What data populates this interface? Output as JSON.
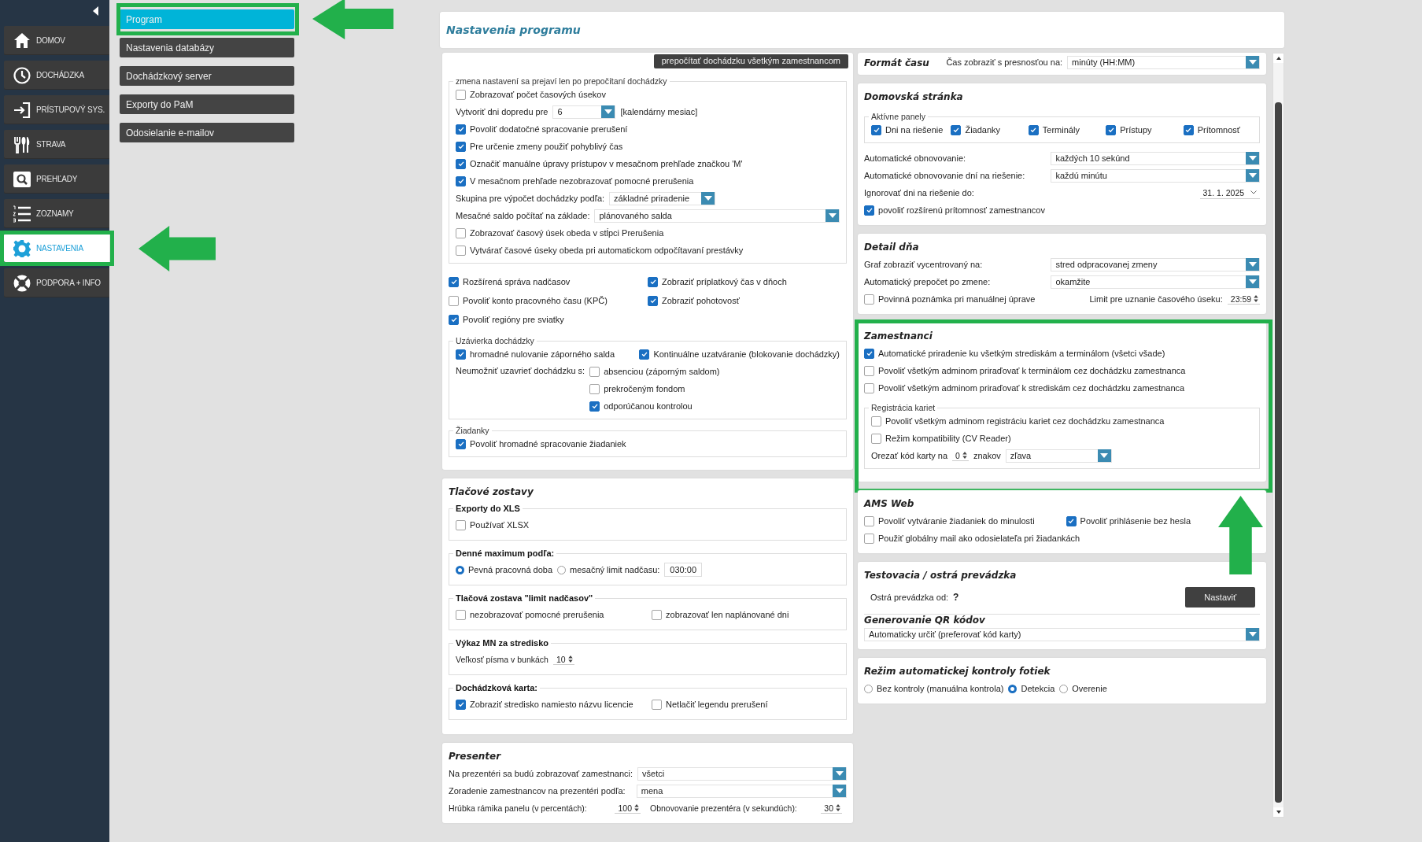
{
  "sidebar": {
    "items": [
      {
        "label": "DOMOV",
        "selected": false,
        "highlighted": false
      },
      {
        "label": "DOCHÁDZKA",
        "selected": false,
        "highlighted": false
      },
      {
        "label": "PRÍSTUPOVÝ SYS.",
        "selected": false,
        "highlighted": false
      },
      {
        "label": "STRAVA",
        "selected": false,
        "highlighted": false
      },
      {
        "label": "PREHĽADY",
        "selected": false,
        "highlighted": false
      },
      {
        "label": "ZOZNAMY",
        "selected": false,
        "highlighted": false
      },
      {
        "label": "NASTAVENIA",
        "selected": true,
        "highlighted": true
      },
      {
        "label": "PODPORA + INFO",
        "selected": false,
        "highlighted": false
      }
    ]
  },
  "submenu": [
    {
      "label": "Program",
      "selected": true,
      "highlighted": true
    },
    {
      "label": "Nastavenia databázy",
      "selected": false,
      "highlighted": false
    },
    {
      "label": "Dochádzkový server",
      "selected": false,
      "highlighted": false
    },
    {
      "label": "Exporty do PaM",
      "selected": false,
      "highlighted": false
    },
    {
      "label": "Odosielanie e-mailov",
      "selected": false,
      "highlighted": false
    }
  ],
  "header": {
    "title": "Nastavenia programu"
  },
  "left_column": [
    {
      "kind": "panel",
      "highlighted": false,
      "rows": [
        {
          "kind": "button",
          "label": "prepočítať dochádzku všetkým zamestnancom"
        },
        {
          "kind": "fieldset",
          "legend": "zmena nastavení sa prejaví len po prepočítaní dochádzky",
          "rows": [
            {
              "kind": "check",
              "label": "Zobrazovať počet časových úsekov",
              "checked": false
            },
            {
              "kind": "select-suffix",
              "label": "Vytvoriť dni dopredu pre",
              "value": "6",
              "suffix": "[kalendárny mesiac]"
            },
            {
              "kind": "check",
              "label": "Povoliť dodatočné spracovanie prerušení",
              "checked": true
            },
            {
              "kind": "check",
              "label": "Pre určenie zmeny použiť pohyblivý čas",
              "checked": true
            },
            {
              "kind": "check",
              "label": "Označiť manuálne úpravy prístupov v mesačnom prehľade značkou 'M'",
              "checked": true
            },
            {
              "kind": "check",
              "label": "V mesačnom prehľade nezobrazovať pomocné prerušenia",
              "checked": true
            },
            {
              "kind": "select-inline",
              "label": "Skupina pre výpočet dochádzky podľa:",
              "value": "základné priradenie"
            },
            {
              "kind": "select-fill",
              "label": "Mesačné saldo počítať na základe:",
              "value": "plánovaného salda"
            },
            {
              "kind": "check",
              "label": "Zobrazovať časový úsek obeda v stĺpci Prerušenia",
              "checked": false
            },
            {
              "kind": "check",
              "label": "Vytvárať časové úseky obeda pri automatickom odpočítavaní prestávky",
              "checked": false
            }
          ]
        },
        {
          "kind": "check-grid",
          "items": [
            {
              "label": "Rozšírená správa nadčasov",
              "checked": true
            },
            {
              "label": "Zobraziť príplatkový čas v dňoch",
              "checked": true
            },
            {
              "label": "Povoliť konto pracovného času (KPČ)",
              "checked": false
            },
            {
              "label": "Zobraziť pohotovosť",
              "checked": true
            },
            {
              "label": "Povoliť regióny pre sviatky",
              "checked": true
            }
          ]
        },
        {
          "kind": "fieldset",
          "legend": "Uzávierka dochádzky",
          "rows": [
            {
              "kind": "checks",
              "items": [
                {
                  "label": "hromadné nulovanie záporného salda",
                  "checked": true
                },
                {
                  "label": "Kontinuálne uzatváranie (blokovanie dochádzky)",
                  "checked": true
                }
              ]
            },
            {
              "kind": "check-stack",
              "label": "Neumožniť uzavrieť dochádzku s:",
              "items": [
                {
                  "label": "absenciou (záporným saldom)",
                  "checked": false
                },
                {
                  "label": "prekročeným fondom",
                  "checked": false
                },
                {
                  "label": "odporúčanou kontrolou",
                  "checked": true
                }
              ]
            }
          ]
        },
        {
          "kind": "fieldset",
          "legend": "Žiadanky",
          "rows": [
            {
              "kind": "check",
              "label": "Povoliť hromadné spracovanie žiadaniek",
              "checked": true
            }
          ]
        }
      ]
    },
    {
      "kind": "panel",
      "title": "Tlačové zostavy",
      "highlighted": false,
      "rows": [
        {
          "kind": "group",
          "legend": "Exporty do XLS",
          "rows": [
            {
              "kind": "check",
              "label": "Používať XLSX",
              "checked": false
            }
          ]
        },
        {
          "kind": "group",
          "legend": "Denné maximum podľa:",
          "rows": [
            {
              "kind": "radios",
              "items": [
                {
                  "label": "Pevná pracovná doba",
                  "selected": true
                },
                {
                  "label": "mesačný limit nadčasu:",
                  "selected": false
                }
              ],
              "input": "030:00"
            }
          ]
        },
        {
          "kind": "group",
          "legend": "Tlačová zostava \"limit nadčasov\"",
          "rows": [
            {
              "kind": "checks",
              "items": [
                {
                  "label": "nezobrazovať pomocné prerušenia",
                  "checked": false
                },
                {
                  "label": "zobrazovať len naplánované dni",
                  "checked": false
                }
              ]
            }
          ]
        },
        {
          "kind": "group",
          "legend": "Výkaz MN za stredisko",
          "rows": [
            {
              "kind": "spinner",
              "label": "Veľkosť písma v bunkách",
              "value": "10"
            }
          ]
        },
        {
          "kind": "group",
          "legend": "Dochádzková karta:",
          "rows": [
            {
              "kind": "checks",
              "items": [
                {
                  "label": "Zobraziť stredisko namiesto názvu licencie",
                  "checked": true
                },
                {
                  "label": "Netlačiť legendu prerušení",
                  "checked": false
                }
              ]
            }
          ]
        }
      ]
    },
    {
      "kind": "panel",
      "title": "Presenter",
      "highlighted": false,
      "rows": [
        {
          "kind": "select",
          "label": "Na prezentéri sa budú zobrazovať zamestnanci:",
          "value": "všetci"
        },
        {
          "kind": "select",
          "label": "Zoradenie zamestnancov na prezentéri podľa:",
          "value": "mena"
        },
        {
          "kind": "spinners",
          "items": [
            {
              "label": "Hrúbka rámika panelu (v percentách):",
              "value": "100"
            },
            {
              "label": "Obnovovanie prezentéra  (v sekundúch):",
              "value": "30"
            }
          ]
        }
      ]
    }
  ],
  "right_column": [
    {
      "kind": "bar",
      "title": "Formát času",
      "highlighted": false,
      "rows": [
        {
          "kind": "select-right",
          "label": "Čas zobraziť s presnosťou na:",
          "value": "minúty (HH:MM)"
        }
      ]
    },
    {
      "kind": "panel",
      "title": "Domovská stránka",
      "highlighted": false,
      "rows": [
        {
          "kind": "fieldset",
          "legend": "Aktívne panely",
          "rows": [
            {
              "kind": "checks",
              "items": [
                {
                  "label": "Dni na riešenie",
                  "checked": true
                },
                {
                  "label": "Žiadanky",
                  "checked": true
                },
                {
                  "label": "Terminály",
                  "checked": true
                },
                {
                  "label": "Prístupy",
                  "checked": true
                },
                {
                  "label": "Prítomnosť",
                  "checked": true
                }
              ]
            }
          ]
        },
        {
          "kind": "select",
          "label": "Automatické obnovovanie:",
          "value": "každých 10 sekúnd"
        },
        {
          "kind": "select",
          "label": "Automatické obnovovanie dní na riešenie:",
          "value": "každú minútu"
        },
        {
          "kind": "date",
          "label": "Ignorovať dni na riešenie do:",
          "value": "31. 1. 2025"
        },
        {
          "kind": "check",
          "label": "povoliť rozšírenú prítomnosť zamestnancov",
          "checked": true
        }
      ]
    },
    {
      "kind": "panel",
      "title": "Detail dňa",
      "highlighted": false,
      "rows": [
        {
          "kind": "select",
          "label": "Graf zobraziť vycentrovaný na:",
          "value": "stred odpracovanej zmeny"
        },
        {
          "kind": "select",
          "label": "Automatický prepočet po zmene:",
          "value": "okamžite"
        },
        {
          "kind": "check-spinner",
          "label": "Povinná poznámka pri manuálnej úprave",
          "checked": false,
          "spinner": {
            "label": "Limit pre uznanie časového úseku:",
            "value": "23:59"
          }
        }
      ]
    },
    {
      "kind": "panel",
      "title": "Zamestnanci",
      "highlighted": true,
      "rows": [
        {
          "kind": "check",
          "label": "Automatické priradenie ku všetkým strediskám a terminálom (všetci všade)",
          "checked": true
        },
        {
          "kind": "check",
          "label": "Povoliť všetkým adminom priraďovať k terminálom cez dochádzku zamestnanca",
          "checked": false
        },
        {
          "kind": "check",
          "label": "Povoliť všetkým adminom priraďovať k strediskám cez dochádzku zamestnanca",
          "checked": false
        },
        {
          "kind": "fieldset",
          "legend": "Registrácia kariet",
          "rows": [
            {
              "kind": "check",
              "label": "Povoliť všetkým adminom registráciu kariet cez dochádzku zamestnanca",
              "checked": false
            },
            {
              "kind": "check",
              "label": "Režim kompatibility (CV Reader)",
              "checked": false
            },
            {
              "kind": "trim",
              "label": "Orezať kód karty na",
              "spin": "0",
              "unit": "znakov",
              "value": "zľava"
            }
          ]
        }
      ]
    },
    {
      "kind": "panel",
      "title": "AMS Web",
      "highlighted": false,
      "rows": [
        {
          "kind": "checks",
          "items": [
            {
              "label": "Povoliť vytváranie žiadaniek do minulosti",
              "checked": false
            },
            {
              "label": "Povoliť prihlásenie bez hesla",
              "checked": true
            }
          ]
        },
        {
          "kind": "check",
          "label": "Použiť globálny mail ako odosielateľa pri žiadankách",
          "checked": false
        }
      ]
    },
    {
      "kind": "panel",
      "title": "Testovacia / ostrá prevádzka",
      "highlighted": false,
      "rows": [
        {
          "kind": "live-date",
          "label": "Ostrá prevádzka od:",
          "value": "?",
          "button": "Nastaviť"
        },
        {
          "kind": "subtitle",
          "label": "Generovanie QR kódov"
        },
        {
          "kind": "select-full",
          "value": "Automaticky určiť (preferovať kód karty)"
        }
      ]
    },
    {
      "kind": "panel",
      "title": "Režim automatickej kontroly fotiek",
      "highlighted": false,
      "rows": [
        {
          "kind": "radios",
          "items": [
            {
              "label": "Bez kontroly (manuálna kontrola)",
              "selected": false
            },
            {
              "label": "Detekcia",
              "selected": true
            },
            {
              "label": "Overenie",
              "selected": false
            }
          ]
        }
      ]
    }
  ]
}
